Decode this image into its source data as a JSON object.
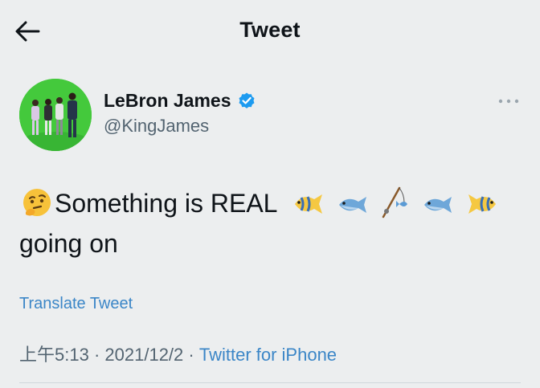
{
  "header": {
    "title": "Tweet",
    "back_icon": "arrow-left-icon"
  },
  "author": {
    "name": "LeBron James",
    "handle": "@KingJames",
    "verified": true,
    "verified_color": "#1d9bf0",
    "avatar_bg": "#3fc23a"
  },
  "tweet": {
    "line1_text": "Something is REAL",
    "line2_text": "going on",
    "emojis": [
      "thinking-face-icon",
      "tropical-fish-icon",
      "fish-icon",
      "fishing-pole-icon",
      "fish-icon",
      "tropical-fish-icon"
    ]
  },
  "translate_label": "Translate Tweet",
  "meta": {
    "time": "上午5:13",
    "date": "2021/12/2",
    "separator": "·",
    "source": "Twitter for iPhone"
  },
  "colors": {
    "background": "#eceeef",
    "link": "#3b86c7",
    "secondary_text": "#536471"
  }
}
